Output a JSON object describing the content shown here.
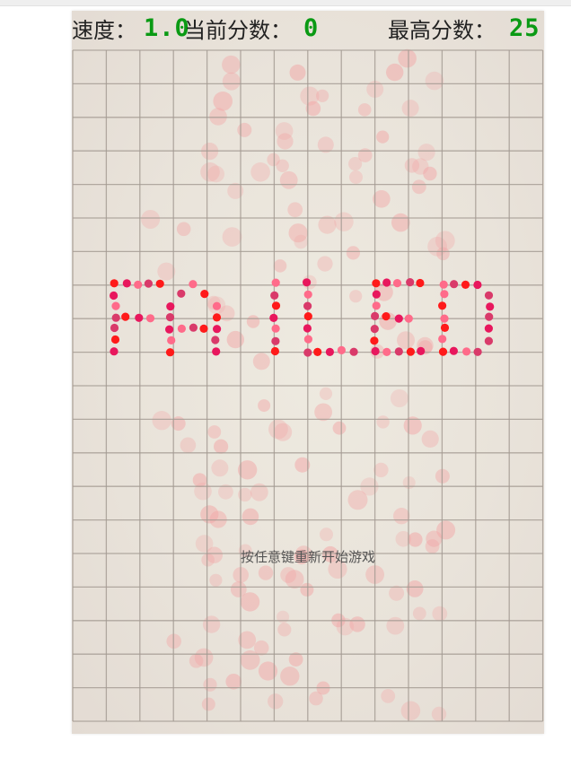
{
  "scoreboard": {
    "speed_label": "速度：",
    "speed_value": "1.0",
    "current_score_label": "当前分数：",
    "current_score_value": "0",
    "high_score_label": "最高分数：",
    "high_score_value": "25"
  },
  "game_over": {
    "banner_text": "FAILED",
    "restart_hint": "按任意键重新开始游戏"
  },
  "colors": {
    "value_green": "#0a9a14",
    "grid_line": "#a39a92",
    "banner_dots": [
      "#ff1a1a",
      "#e8175d",
      "#ff6b8a",
      "#d93a6a"
    ],
    "bubble": "#f2a6a6"
  }
}
